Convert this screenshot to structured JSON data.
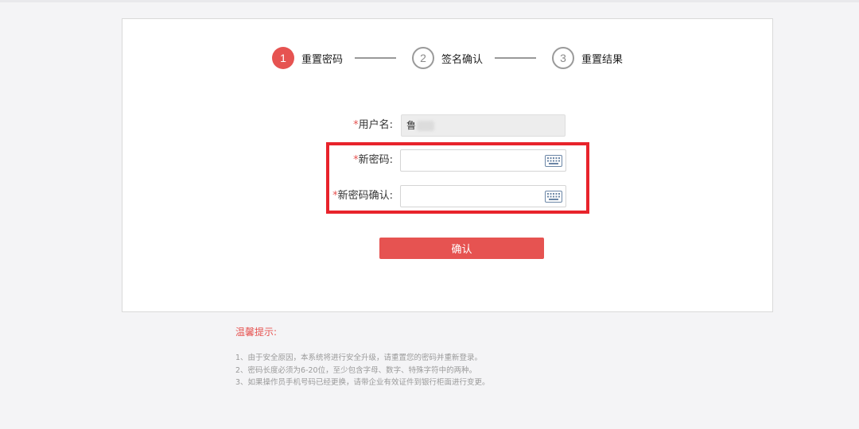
{
  "steps": [
    {
      "number": "1",
      "label": "重置密码",
      "state": "active"
    },
    {
      "number": "2",
      "label": "签名确认",
      "state": "inactive"
    },
    {
      "number": "3",
      "label": "重置结果",
      "state": "inactive"
    }
  ],
  "form": {
    "username": {
      "required_mark": "*",
      "label": "用户名:",
      "value": "鲁"
    },
    "new_password": {
      "required_mark": "*",
      "label": "新密码:",
      "value": "",
      "keyboard_icon": "keyboard-icon"
    },
    "confirm_password": {
      "required_mark": "*",
      "label": "新密码确认:",
      "value": "",
      "keyboard_icon": "keyboard-icon"
    },
    "submit_label": "确认"
  },
  "tips": {
    "title": "温馨提示:",
    "items": [
      "1、由于安全原因，本系统将进行安全升级，请重置您的密码并重新登录。",
      "2、密码长度必须为6-20位，至少包含字母、数字、特殊字符中的两种。",
      "3、如果操作员手机号码已经更换，请带企业有效证件到银行柜面进行变更。"
    ]
  },
  "colors": {
    "accent": "#e65351",
    "highlight": "#e8232b",
    "background": "#f4f4f6"
  }
}
